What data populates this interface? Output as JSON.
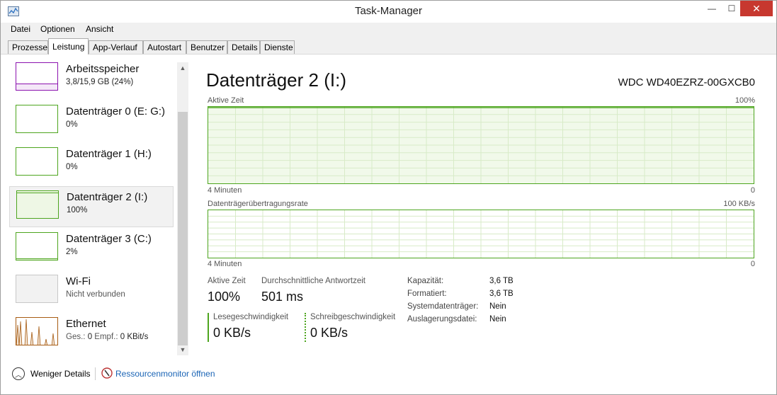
{
  "window": {
    "title": "Task-Manager",
    "close_glyph": "✕",
    "min_glyph": "—",
    "max_glyph": "☐"
  },
  "menu": {
    "items": [
      "Datei",
      "Optionen",
      "Ansicht"
    ]
  },
  "tabs": [
    "Prozesse",
    "Leistung",
    "App-Verlauf",
    "Autostart",
    "Benutzer",
    "Details",
    "Dienste"
  ],
  "active_tab": "Leistung",
  "sidebar": {
    "items": [
      {
        "name": "Arbeitsspeicher",
        "value": "3,8/15,9 GB (24%)",
        "color": "#8b12ae",
        "selected": false
      },
      {
        "name": "Datenträger 0 (E: G:)",
        "value": "0%",
        "color": "#4da51e",
        "selected": false
      },
      {
        "name": "Datenträger 1 (H:)",
        "value": "0%",
        "color": "#4da51e",
        "selected": false
      },
      {
        "name": "Datenträger 2 (I:)",
        "value": "100%",
        "color": "#4da51e",
        "selected": true
      },
      {
        "name": "Datenträger 3 (C:)",
        "value": "2%",
        "color": "#4da51e",
        "selected": false
      },
      {
        "name": "Wi-Fi",
        "value": "Nicht verbunden",
        "color": "#d0d0d0",
        "selected": false
      },
      {
        "name": "Ethernet",
        "value_prefix_send": "Ges.:",
        "send": "0",
        "value_prefix_recv": "Empf.:",
        "recv": "0 KBit/s",
        "color": "#a75c13",
        "selected": false
      }
    ]
  },
  "main": {
    "title": "Datenträger 2 (I:)",
    "model": "WDC WD40EZRZ-00GXCB0",
    "graph1": {
      "label": "Aktive Zeit",
      "max": "100%",
      "time": "4 Minuten",
      "min": "0",
      "level": 1.0
    },
    "graph2": {
      "label": "Datenträgerübertragungsrate",
      "max": "100 KB/s",
      "time": "4 Minuten",
      "min": "0",
      "level": 0.0
    },
    "stats": {
      "active_time_label": "Aktive Zeit",
      "active_time": "100%",
      "response_label": "Durchschnittliche Antwortzeit",
      "response": "501 ms",
      "read_label": "Lesegeschwindigkeit",
      "read": "0 KB/s",
      "write_label": "Schreibgeschwindigkeit",
      "write": "0 KB/s"
    },
    "props": [
      {
        "key": "Kapazität:",
        "value": "3,6 TB"
      },
      {
        "key": "Formatiert:",
        "value": "3,6 TB"
      },
      {
        "key": "Systemdatenträger:",
        "value": "Nein"
      },
      {
        "key": "Auslagerungsdatei:",
        "value": "Nein"
      }
    ]
  },
  "footer": {
    "less_details": "Weniger Details",
    "resmon": "Ressourcenmonitor öffnen"
  },
  "colors": {
    "disk_green": "#4da51e",
    "fill_green": "#eef7e5",
    "grid": "#d8ebc8"
  }
}
